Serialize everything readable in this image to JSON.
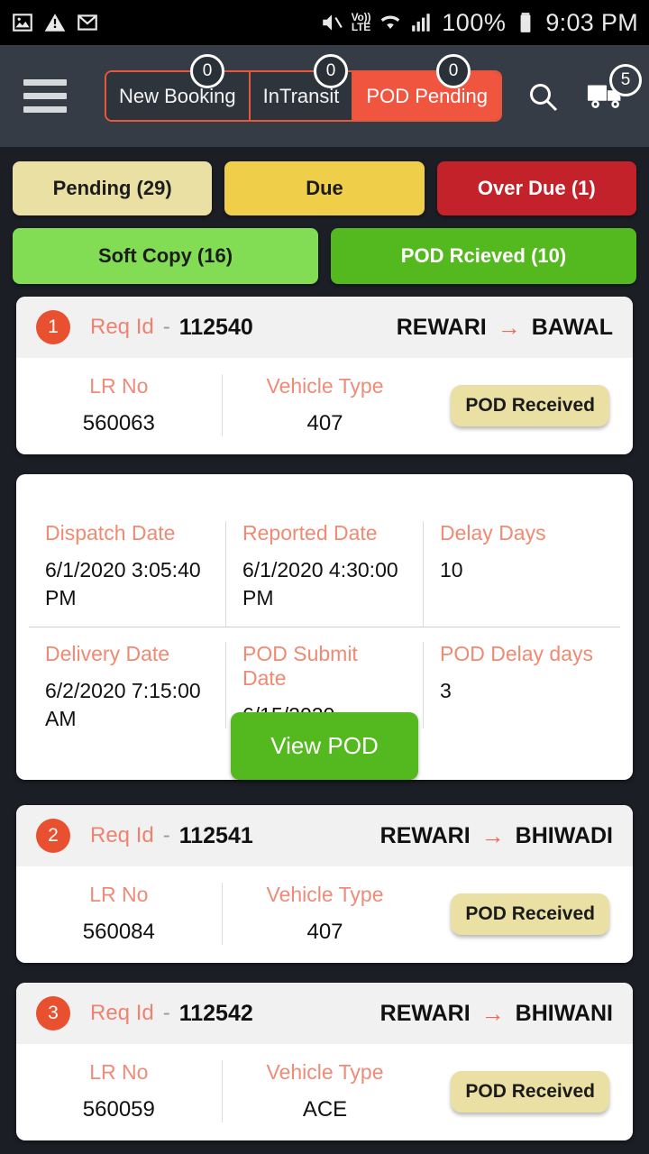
{
  "statusbar": {
    "icons": [
      "image-icon",
      "warning-icon",
      "gmail-icon"
    ],
    "mute_icon": "mute-icon",
    "volte_top": "Vo))",
    "volte_bottom": "LTE",
    "wifi_icon": "wifi-icon",
    "signal_icon": "signal-icon",
    "battery_percent": "100%",
    "battery_icon": "battery-full-icon",
    "time": "9:03 PM"
  },
  "appbar": {
    "menu_icon": "hamburger-menu-icon",
    "search_icon": "search-icon",
    "truck_icon": "truck-icon",
    "truck_badge": "5",
    "tabs": [
      {
        "label": "New Booking",
        "badge": "0",
        "active": false
      },
      {
        "label": "InTransit",
        "badge": "0",
        "active": false
      },
      {
        "label": "POD Pending",
        "badge": "0",
        "active": true
      }
    ]
  },
  "filters": {
    "row1": [
      {
        "label": "Pending (29)",
        "color": "#ebe0a4"
      },
      {
        "label": "Due",
        "color": "#efcf4a"
      },
      {
        "label": "Over Due (1)",
        "color": "#c4222a"
      }
    ],
    "row2": [
      {
        "label": "Soft Copy (16)",
        "color": "#82dd55"
      },
      {
        "label": "POD Rcieved (10)",
        "color": "#53b91e"
      }
    ]
  },
  "labels": {
    "req_id": "Req Id",
    "dash": "-",
    "lr_no": "LR No",
    "vehicle_type": "Vehicle Type",
    "arrow": "→",
    "dispatch_date": "Dispatch Date",
    "reported_date": "Reported Date",
    "delay_days": "Delay Days",
    "delivery_date": "Delivery Date",
    "pod_submit_date": "POD Submit Date",
    "pod_delay_days": "POD Delay days",
    "view_pod": "View POD"
  },
  "cards": [
    {
      "index": "1",
      "req_id": "112540",
      "origin": "REWARI",
      "destination": "BAWAL",
      "lr_no": "560063",
      "vehicle_type": "407",
      "status": "POD Received"
    },
    {
      "index": "2",
      "req_id": "112541",
      "origin": "REWARI",
      "destination": "BHIWADI",
      "lr_no": "560084",
      "vehicle_type": "407",
      "status": "POD Received"
    },
    {
      "index": "3",
      "req_id": "112542",
      "origin": "REWARI",
      "destination": "BHIWANI",
      "lr_no": "560059",
      "vehicle_type": "ACE",
      "status": "POD Received"
    }
  ],
  "detail": {
    "dispatch_date": "6/1/2020 3:05:40 PM",
    "reported_date": "6/1/2020 4:30:00 PM",
    "delay_days": "10",
    "delivery_date": "6/2/2020 7:15:00 AM",
    "pod_submit_date": "6/15/2020 12:00:00 AM",
    "pod_delay_days": "3"
  }
}
